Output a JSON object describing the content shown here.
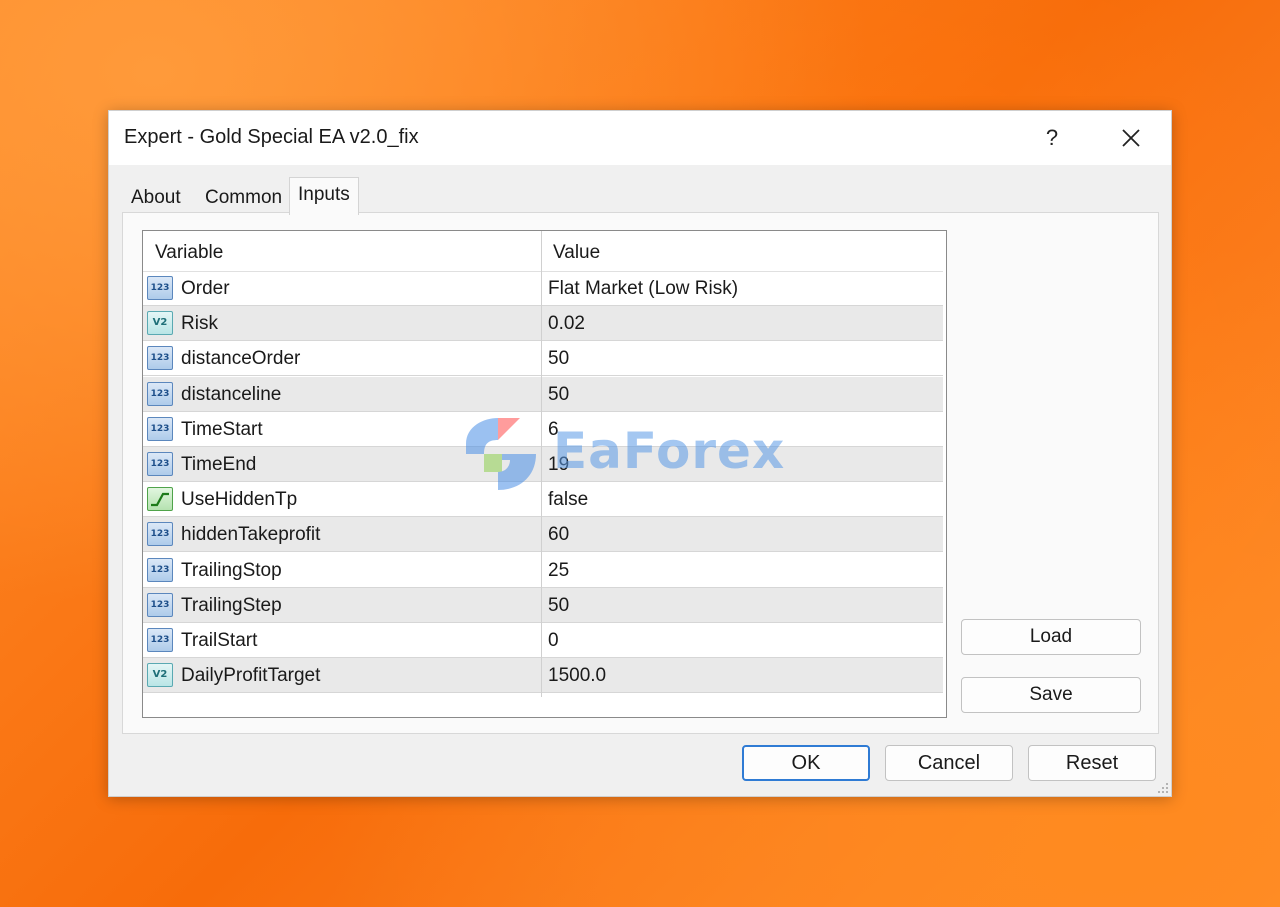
{
  "window": {
    "title": "Expert - Gold Special EA v2.0_fix",
    "help_label": "?"
  },
  "tabs": [
    {
      "label": "About"
    },
    {
      "label": "Common"
    },
    {
      "label": "Inputs",
      "active": true
    }
  ],
  "table": {
    "columns": [
      "Variable",
      "Value"
    ],
    "rows": [
      {
        "type": "int",
        "icon": "int-type-icon",
        "icon_text": "123",
        "variable": "Order",
        "value": "Flat Market (Low Risk)"
      },
      {
        "type": "double",
        "icon": "double-type-icon",
        "icon_text": "V2",
        "variable": "Risk",
        "value": "0.02"
      },
      {
        "type": "int",
        "icon": "int-type-icon",
        "icon_text": "123",
        "variable": "distanceOrder",
        "value": "50"
      },
      {
        "type": "int",
        "icon": "int-type-icon",
        "icon_text": "123",
        "variable": "distanceline",
        "value": "50"
      },
      {
        "type": "int",
        "icon": "int-type-icon",
        "icon_text": "123",
        "variable": "TimeStart",
        "value": "6"
      },
      {
        "type": "int",
        "icon": "int-type-icon",
        "icon_text": "123",
        "variable": "TimeEnd",
        "value": "19"
      },
      {
        "type": "bool",
        "icon": "bool-type-icon",
        "icon_text": "",
        "variable": "UseHiddenTp",
        "value": "false"
      },
      {
        "type": "int",
        "icon": "int-type-icon",
        "icon_text": "123",
        "variable": "hiddenTakeprofit",
        "value": "60"
      },
      {
        "type": "int",
        "icon": "int-type-icon",
        "icon_text": "123",
        "variable": "TrailingStop",
        "value": "25"
      },
      {
        "type": "int",
        "icon": "int-type-icon",
        "icon_text": "123",
        "variable": "TrailingStep",
        "value": "50"
      },
      {
        "type": "int",
        "icon": "int-type-icon",
        "icon_text": "123",
        "variable": "TrailStart",
        "value": "0"
      },
      {
        "type": "double",
        "icon": "double-type-icon",
        "icon_text": "V2",
        "variable": "DailyProfitTarget",
        "value": "1500.0"
      }
    ]
  },
  "side_buttons": {
    "load_label": "Load",
    "save_label": "Save"
  },
  "footer": {
    "ok_label": "OK",
    "cancel_label": "Cancel",
    "reset_label": "Reset"
  },
  "watermark": {
    "text": "EaForex"
  },
  "colors": {
    "primary_border": "#2f7bd4",
    "watermark": "#5a9ae6"
  }
}
